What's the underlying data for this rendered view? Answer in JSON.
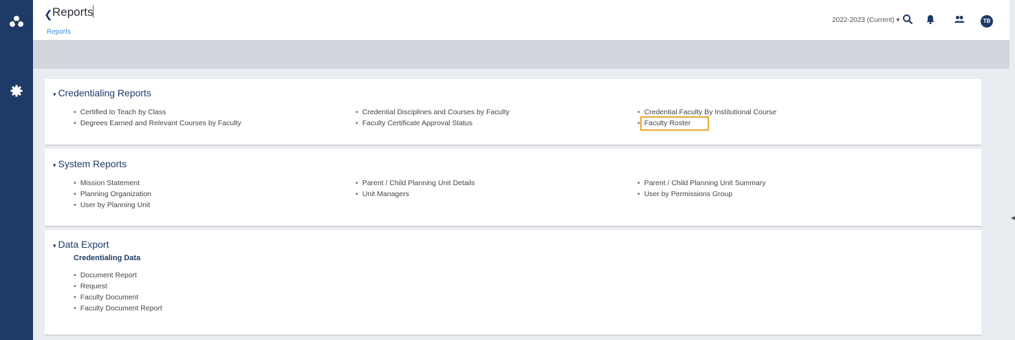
{
  "header": {
    "title": "Reports",
    "breadcrumb": "Reports",
    "year_select": "2022-2023 (Current) ▾",
    "avatar_initials": "TB"
  },
  "sections": [
    {
      "title": "Credentialing Reports",
      "columns": [
        [
          "Certified to Teach by Class",
          "Degrees Earned and Relevant Courses by Faculty"
        ],
        [
          "Credential Disciplines and Courses by Faculty",
          "Faculty Certificate Approval Status"
        ],
        [
          "Credential Faculty By Institutional Course",
          "Faculty Roster"
        ]
      ]
    },
    {
      "title": "System Reports",
      "columns": [
        [
          "Mission Statement",
          "Planning Organization",
          "User by Planning Unit"
        ],
        [
          "Parent / Child Planning Unit Details",
          "Unit Managers"
        ],
        [
          "Parent / Child Planning Unit Summary",
          "User by Permissions Group"
        ]
      ]
    },
    {
      "title": "Data Export",
      "subheading": "Credentialing Data",
      "items": [
        "Document Report",
        "Request",
        "Faculty Document",
        "Faculty Document Report"
      ]
    }
  ],
  "colors": {
    "rail": "#1e3a66",
    "accent_link": "#3b8bd6",
    "highlight": "#e8a82c"
  }
}
